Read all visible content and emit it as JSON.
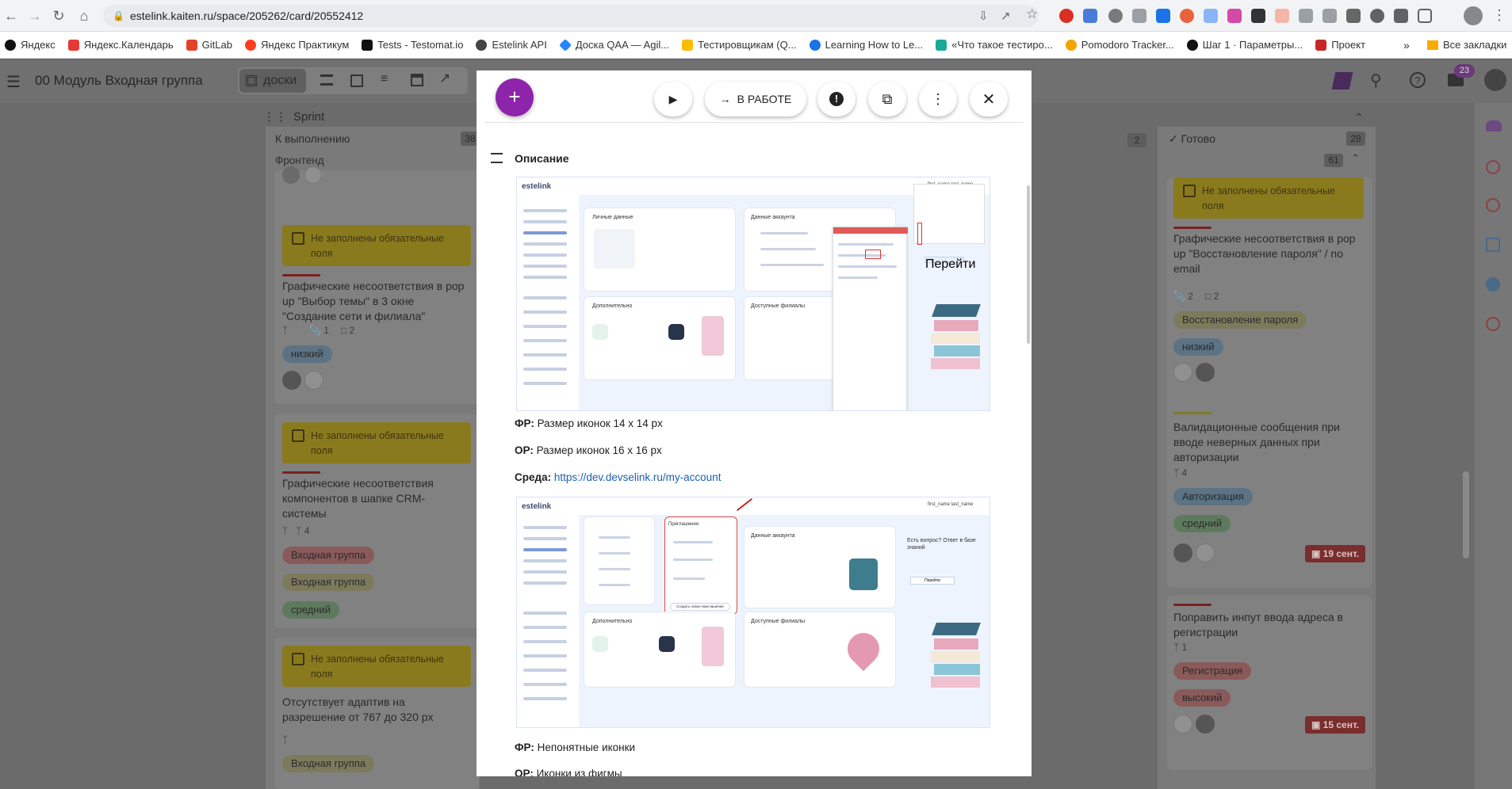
{
  "browser": {
    "url": "estelink.kaiten.ru/space/205262/card/20552412",
    "bookmarks": [
      "Яндекс",
      "Яндекс.Календарь",
      "GitLab",
      "Яндекс Практикум",
      "Tests - Testomat.io",
      "Estelink API",
      "Доска QAA — Agil...",
      "Тестировщикам (Q...",
      "Learning How to Le...",
      "«Что такое тестиро...",
      "Pomodoro Tracker...",
      "Шаг 1 · Параметры...",
      "Проект"
    ],
    "more": "»",
    "all_bookmarks": "Все закладки"
  },
  "app": {
    "title": "00 Модуль Входная группа",
    "view_tab": "доски",
    "notification_count": "23"
  },
  "board": {
    "lane": "Sprint",
    "columns": [
      {
        "title": "К выполнению",
        "count": "38"
      },
      {
        "title": "",
        "count": "2"
      },
      {
        "title": "Готово",
        "count": "28"
      }
    ],
    "group": "Фронтенд",
    "group_count": "61",
    "left_cards": [
      {
        "warning": "Не заполнены обязательные поля",
        "title": "Графические несоответствия в pop up \"Выбор темы\" в 3 окне \"Создание сети и филиала\"",
        "attachments": "1",
        "comments": "2",
        "tags": [
          "низкий"
        ]
      },
      {
        "warning": "Не заполнены обязательные поля",
        "title": "Графические несоответствия компонентов в шапке CRM-системы",
        "subtasks": "4",
        "tags": [
          "Входная группа",
          "Входная группа",
          "средний"
        ]
      },
      {
        "warning": "Не заполнены обязательные поля",
        "title": "Отсутствует адаптив на разрешение от 767 до 320 px",
        "tags": [
          "Входная группа"
        ]
      }
    ],
    "right_cards": [
      {
        "warning": "Не заполнены обязательные поля",
        "title": "Графические несоответствия в pop up \"Восстановление пароля\" / no email",
        "attachments": "2",
        "comments": "2",
        "tags": [
          "Восстановление пароля",
          "низкий"
        ]
      },
      {
        "title": "Валидационные сообщения при вводе неверных данных при авторизации",
        "subtasks": "4",
        "tags": [
          "Авторизация",
          "средний"
        ],
        "date": "19 сент."
      },
      {
        "title": "Поправить инпут ввода адреса в регистрации",
        "subtasks": "1",
        "tags": [
          "Регистрация",
          "высокий"
        ],
        "date": "15 сент."
      }
    ]
  },
  "modal": {
    "status_button": "В РАБОТЕ",
    "section_title": "Описание",
    "fr1_label": "ФР:",
    "fr1_text": "Размер иконок 14 x 14 px",
    "or1_label": "ОР:",
    "or1_text": "Размер иконок 16 x 16 px",
    "env_label": "Среда:",
    "env_link": "https://dev.devselink.ru/my-account",
    "fr2_label": "ФР:",
    "fr2_text": "Непонятные иконки",
    "or2_label": "ОР:",
    "or2_text": "Иконки из фигмы",
    "shot": {
      "logo": "estelink",
      "user": "first_name last_name",
      "p1": "Личные данные",
      "p2": "Данные аккаунта",
      "p3": "Дополнительно",
      "p4": "Доступные филиалы",
      "p5": "Приглашения",
      "help": "Есть вопрос? Ответ в базе знаний",
      "help_btn": "Перейти",
      "btn_create": "Создать новое приглашение"
    }
  }
}
